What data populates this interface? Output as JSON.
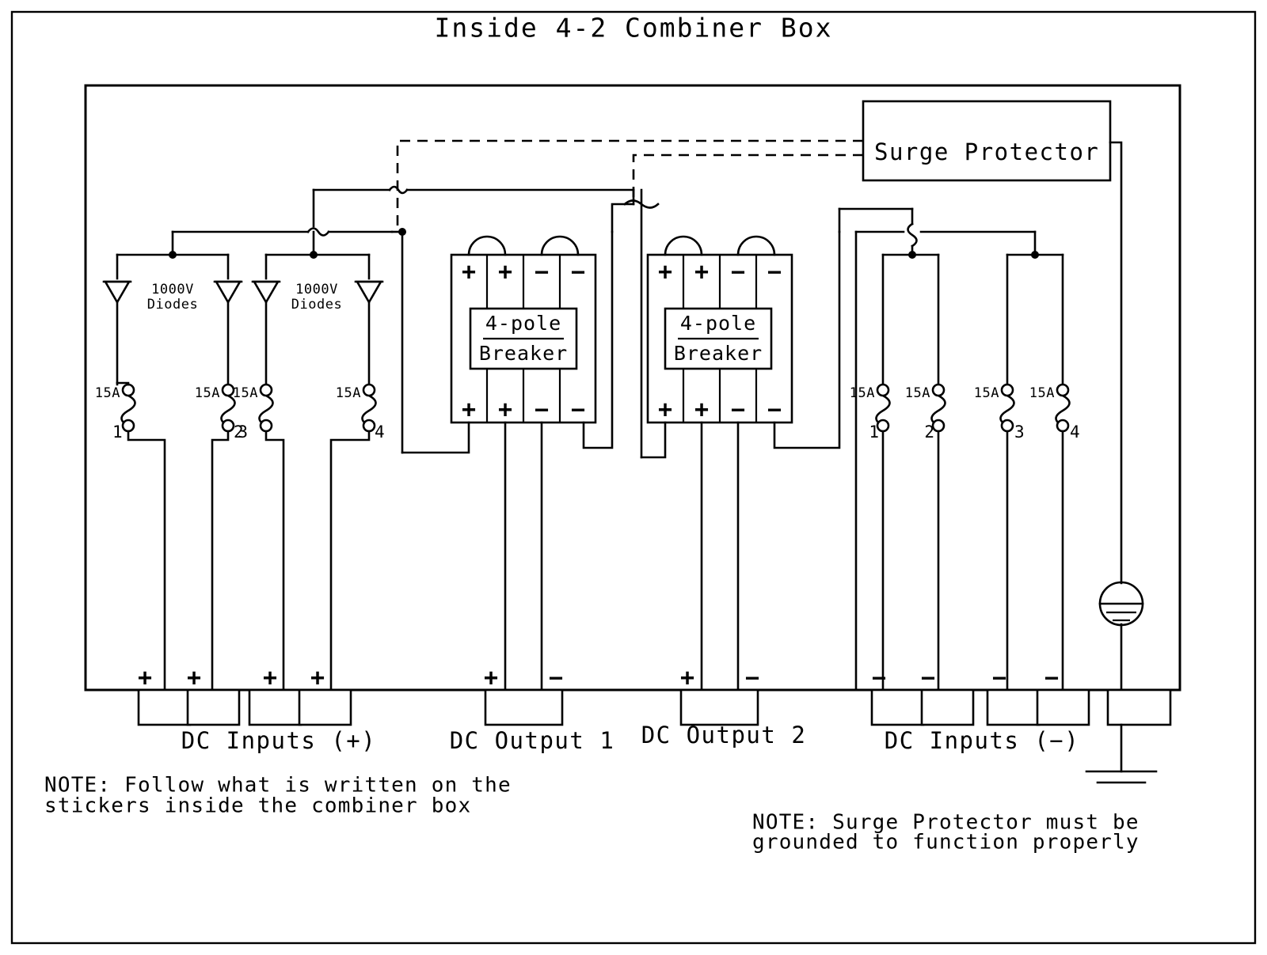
{
  "title": "Inside 4-2 Combiner Box",
  "enclosure": {
    "name": "combiner-box-enclosure"
  },
  "surge_protector": {
    "label": "Surge Protector"
  },
  "diode_groups": [
    {
      "label_line1": "1000V",
      "label_line2": "Diodes"
    },
    {
      "label_line1": "1000V",
      "label_line2": "Diodes"
    }
  ],
  "positive_fuses": [
    {
      "rating": "15A",
      "number": "1"
    },
    {
      "rating": "15A",
      "number": "2"
    },
    {
      "rating": "15A",
      "number": "3"
    },
    {
      "rating": "15A",
      "number": "4"
    }
  ],
  "negative_fuses": [
    {
      "rating": "15A",
      "number": "1"
    },
    {
      "rating": "15A",
      "number": "2"
    },
    {
      "rating": "15A",
      "number": "3"
    },
    {
      "rating": "15A",
      "number": "4"
    }
  ],
  "breakers": [
    {
      "title": "4-pole",
      "subtitle": "Breaker",
      "top_poles": [
        "+",
        "+",
        "−",
        "−"
      ],
      "bottom_poles": [
        "+",
        "+",
        "−",
        "−"
      ]
    },
    {
      "title": "4-pole",
      "subtitle": "Breaker",
      "top_poles": [
        "+",
        "+",
        "−",
        "−"
      ],
      "bottom_poles": [
        "+",
        "+",
        "−",
        "−"
      ]
    }
  ],
  "terminal_groups": [
    {
      "label": "DC Inputs (+)",
      "signs": [
        "+",
        "+",
        "+",
        "+"
      ]
    },
    {
      "label": "DC Output 1",
      "signs": [
        "+",
        "−"
      ]
    },
    {
      "label": "DC Output 2",
      "signs": [
        "+",
        "−"
      ]
    },
    {
      "label": "DC Inputs (−)",
      "signs": [
        "−",
        "−",
        "−",
        "−"
      ]
    }
  ],
  "ground": {
    "symbol_name": "ground-terminal",
    "earth_name": "earth-ground"
  },
  "notes": [
    {
      "line1": "NOTE: Follow what is written on the",
      "line2": "stickers inside the combiner box"
    },
    {
      "line1": "NOTE: Surge Protector must be",
      "line2": "grounded to function properly"
    }
  ],
  "colors": {
    "line": "#000000",
    "background": "#ffffff"
  }
}
